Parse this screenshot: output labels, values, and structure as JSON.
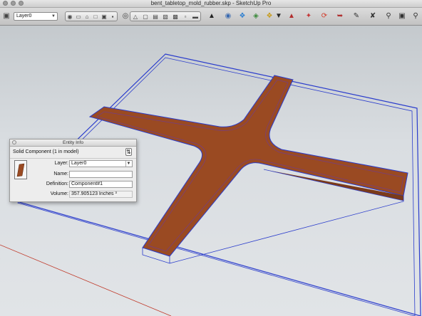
{
  "window": {
    "title": "bent_tabletop_mold_rubber.skp - SketchUp Pro"
  },
  "toolbar": {
    "layer_select_value": "Layer0",
    "icons": [
      "document-icon",
      "print-icon",
      "measure-icon",
      "home-view-icon",
      "section-icon",
      "window-icon",
      "orbit-icon",
      "style-icons",
      "nav-icons",
      "import-icon",
      "select-icon",
      "push-pull-icon",
      "tape-icon",
      "circle-icon",
      "rotate-icon",
      "follow-me-icon",
      "search-icon",
      "zoom-icon"
    ]
  },
  "entity_info": {
    "title": "Entity Info",
    "type_label": "Solid Component (1 in model)",
    "fields": {
      "layer_label": "Layer:",
      "layer_value": "Layer0",
      "name_label": "Name:",
      "name_value": "",
      "definition_label": "Definition:",
      "definition_value": "Component#1",
      "volume_label": "Volume:",
      "volume_value": "357.905123 Inches ³"
    }
  },
  "colors": {
    "model_face": "#9a4a22",
    "model_edge_selected": "#2a3ccc",
    "axis_red": "#c03a2a"
  }
}
